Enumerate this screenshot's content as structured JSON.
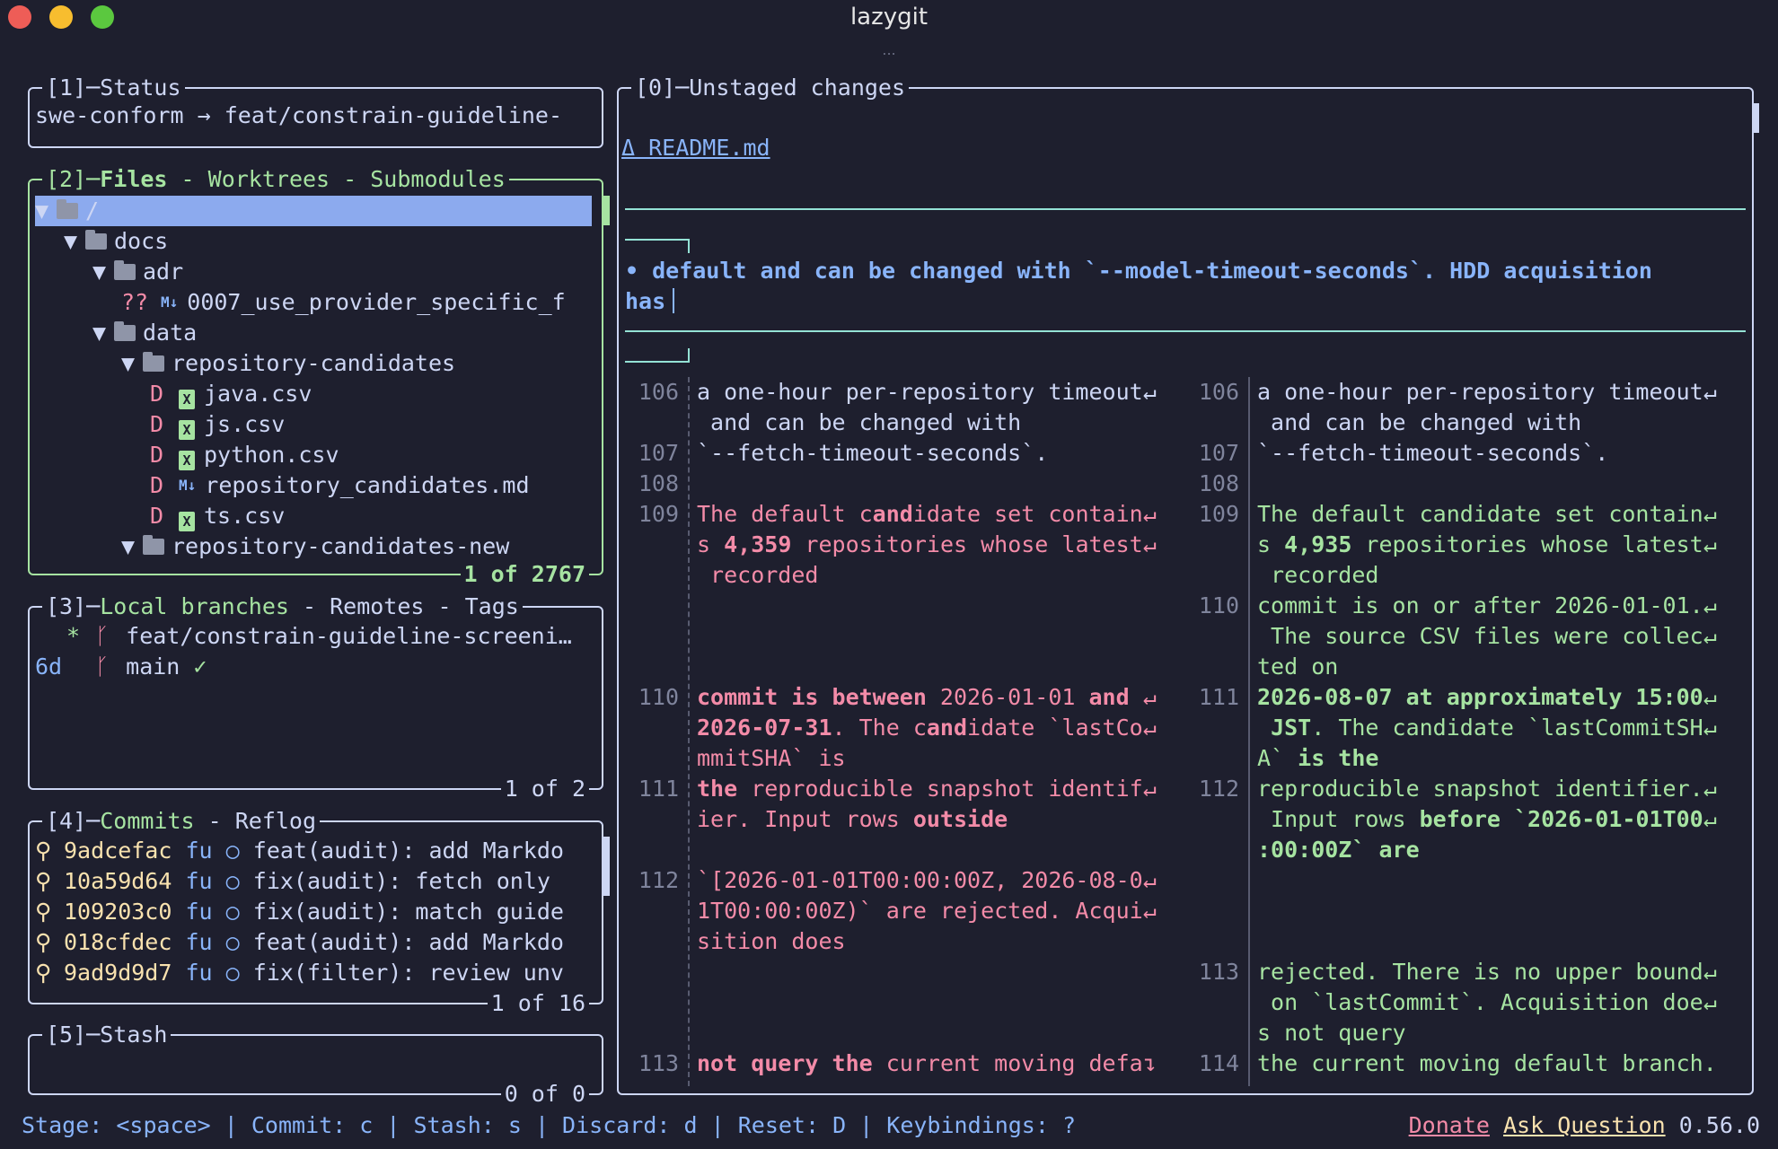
{
  "window": {
    "title": "lazygit",
    "tab_overflow": "..."
  },
  "status": {
    "number": "[1]",
    "title": "Status",
    "text": "swe-conform → feat/constrain-guideline-"
  },
  "files": {
    "number": "[2]",
    "title_active": "Files",
    "tabs_rest": " - Worktrees - Submodules",
    "footer": "1 of 2767",
    "rows": [
      {
        "name": "/",
        "indent": 0,
        "kind": "folder"
      },
      {
        "name": "docs",
        "indent": 1,
        "kind": "folder"
      },
      {
        "name": "adr",
        "indent": 2,
        "kind": "folder"
      },
      {
        "status": "??",
        "name": "0007_use_provider_specific_f",
        "indent": 3,
        "kind": "md"
      },
      {
        "name": "data",
        "indent": 2,
        "kind": "folder"
      },
      {
        "name": "repository-candidates",
        "indent": 3,
        "kind": "folder"
      },
      {
        "status": "D",
        "name": "java.csv",
        "indent": 4,
        "kind": "csv"
      },
      {
        "status": "D",
        "name": "js.csv",
        "indent": 4,
        "kind": "csv"
      },
      {
        "status": "D",
        "name": "python.csv",
        "indent": 4,
        "kind": "csv"
      },
      {
        "status": "D",
        "name": "repository_candidates.md",
        "indent": 4,
        "kind": "md"
      },
      {
        "status": "D",
        "name": "ts.csv",
        "indent": 4,
        "kind": "csv"
      },
      {
        "name": "repository-candidates-new",
        "indent": 3,
        "kind": "folder"
      }
    ]
  },
  "branches": {
    "number": "[3]",
    "title_active": "Local branches",
    "tabs_rest": " - Remotes - Tags",
    "footer": "1 of 2",
    "rows": [
      {
        "prefix": "*",
        "name": "feat/constrain-guideline-screeni…"
      },
      {
        "prefix": "6d",
        "name": "main",
        "check": "✓"
      }
    ]
  },
  "commits": {
    "number": "[4]",
    "title_active": "Commits",
    "tabs_rest": " - Reflog",
    "footer": "1 of 16",
    "rows": [
      {
        "hash": "9adcefac",
        "author": "fu",
        "msg": "feat(audit): add Markdo"
      },
      {
        "hash": "10a59d64",
        "author": "fu",
        "msg": "fix(audit): fetch only"
      },
      {
        "hash": "109203c0",
        "author": "fu",
        "msg": "fix(audit): match guide"
      },
      {
        "hash": "018cfdec",
        "author": "fu",
        "msg": "feat(audit): add Markdo"
      },
      {
        "hash": "9ad9d9d7",
        "author": "fu",
        "msg": "fix(filter): review unv"
      }
    ]
  },
  "stash": {
    "number": "[5]",
    "title": "Stash",
    "footer": "0 of 0"
  },
  "diff": {
    "number": "[0]",
    "title": "Unstaged changes",
    "file": "Δ README.md",
    "bullet_line1": "•  default and can be changed with `--model-timeout-seconds`. HDD acquisition",
    "bullet_line2": "has",
    "left_lines": [
      {
        "n": "106",
        "t": "a one-hour per-repository timeout↵",
        "row": 0
      },
      {
        "n": "",
        "t": " and can be changed with",
        "row": 1
      },
      {
        "n": "107",
        "t": "`--fetch-timeout-seconds`.",
        "row": 2
      },
      {
        "n": "108",
        "t": "",
        "row": 3
      },
      {
        "n": "109",
        "t": "The default candidate set contain↵",
        "row": 4,
        "hl": true
      },
      {
        "n": "",
        "t": "s 4,359 repositories whose latest↵",
        "row": 5,
        "hl": true
      },
      {
        "n": "",
        "t": " recorded",
        "row": 6,
        "hl": true
      },
      {
        "n": "110",
        "t": "commit is between 2026-01-01 and ↵",
        "row": 10,
        "hl": true
      },
      {
        "n": "",
        "t": "2026-07-31. The candidate `lastCo↵",
        "row": 11,
        "hl": true
      },
      {
        "n": "",
        "t": "mmitSHA` is",
        "row": 12,
        "hl": true
      },
      {
        "n": "111",
        "t": "the reproducible snapshot identif↵",
        "row": 13,
        "hl": true
      },
      {
        "n": "",
        "t": "ier. Input rows outside",
        "row": 14,
        "hl": true
      },
      {
        "n": "112",
        "t": "`[2026-01-01T00:00:00Z, 2026-08-0↵",
        "row": 16,
        "hl": true
      },
      {
        "n": "",
        "t": "1T00:00:00Z)` are rejected. Acqui↵",
        "row": 17,
        "hl": true
      },
      {
        "n": "",
        "t": "sition does",
        "row": 18,
        "hl": true
      },
      {
        "n": "113",
        "t": "not query the current moving defa↴",
        "row": 22,
        "hl": true
      }
    ],
    "right_lines": [
      {
        "n": "106",
        "t": "a one-hour per-repository timeout↵",
        "row": 0
      },
      {
        "n": "",
        "t": " and can be changed with",
        "row": 1
      },
      {
        "n": "107",
        "t": "`--fetch-timeout-seconds`.",
        "row": 2
      },
      {
        "n": "108",
        "t": "",
        "row": 3
      },
      {
        "n": "109",
        "t": "The default candidate set contain↵",
        "row": 4
      },
      {
        "n": "",
        "t": "s 4,935 repositories whose latest↵",
        "row": 5
      },
      {
        "n": "",
        "t": " recorded",
        "row": 6
      },
      {
        "n": "110",
        "t": "commit is on or after 2026-01-01.↵",
        "row": 7
      },
      {
        "n": "",
        "t": " The source CSV files were collec↵",
        "row": 8
      },
      {
        "n": "",
        "t": "ted on",
        "row": 9
      },
      {
        "n": "111",
        "t": "2026-08-07 at approximately 15:00↵",
        "row": 10
      },
      {
        "n": "",
        "t": " JST. The candidate `lastCommitSH↵",
        "row": 11
      },
      {
        "n": "",
        "t": "A` is the",
        "row": 12
      },
      {
        "n": "112",
        "t": "reproducible snapshot identifier.↵",
        "row": 13
      },
      {
        "n": "",
        "t": " Input rows before `2026-01-01T00↵",
        "row": 14
      },
      {
        "n": "",
        "t": ":00:00Z` are",
        "row": 15
      },
      {
        "n": "113",
        "t": "rejected. There is no upper bound↵",
        "row": 19
      },
      {
        "n": "",
        "t": " on `lastCommit`. Acquisition doe↵",
        "row": 20
      },
      {
        "n": "",
        "t": "s not query",
        "row": 21
      },
      {
        "n": "114",
        "t": "the current moving default branch.",
        "row": 22
      }
    ]
  },
  "statusbar": {
    "hints": "Stage: <space> | Commit: c | Stash: s | Discard: d | Reset: D | Keybindings: ?",
    "donate": "Donate",
    "ask": "Ask Question",
    "version": "0.56.0"
  },
  "colors": {
    "border": "#cdd6f4",
    "active_border": "#a6e3a1",
    "selection": "#8caaee",
    "deleted": "#f38ba8",
    "added": "#a6e3a1",
    "accent": "#89b4fa"
  }
}
